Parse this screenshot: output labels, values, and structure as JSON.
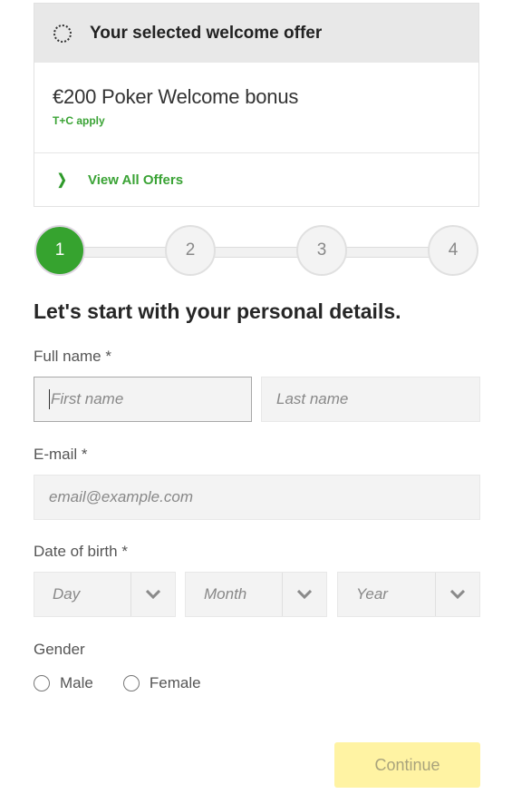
{
  "offer": {
    "header_title": "Your selected welcome offer",
    "name": "€200 Poker Welcome bonus",
    "terms": "T+C apply",
    "view_all_label": "View All Offers"
  },
  "stepper": {
    "current_step": 1,
    "steps": [
      "1",
      "2",
      "3",
      "4"
    ]
  },
  "form": {
    "heading": "Let's start with your personal details.",
    "full_name_label": "Full name *",
    "first_name_placeholder": "First name",
    "last_name_placeholder": "Last name",
    "email_label": "E-mail *",
    "email_placeholder": "email@example.com",
    "dob_label": "Date of birth *",
    "dob_day": "Day",
    "dob_month": "Month",
    "dob_year": "Year",
    "gender_label": "Gender",
    "gender_options": [
      "Male",
      "Female"
    ],
    "continue_label": "Continue"
  },
  "colors": {
    "brand_green": "#36a32f",
    "continue_disabled": "#fff3a3"
  }
}
